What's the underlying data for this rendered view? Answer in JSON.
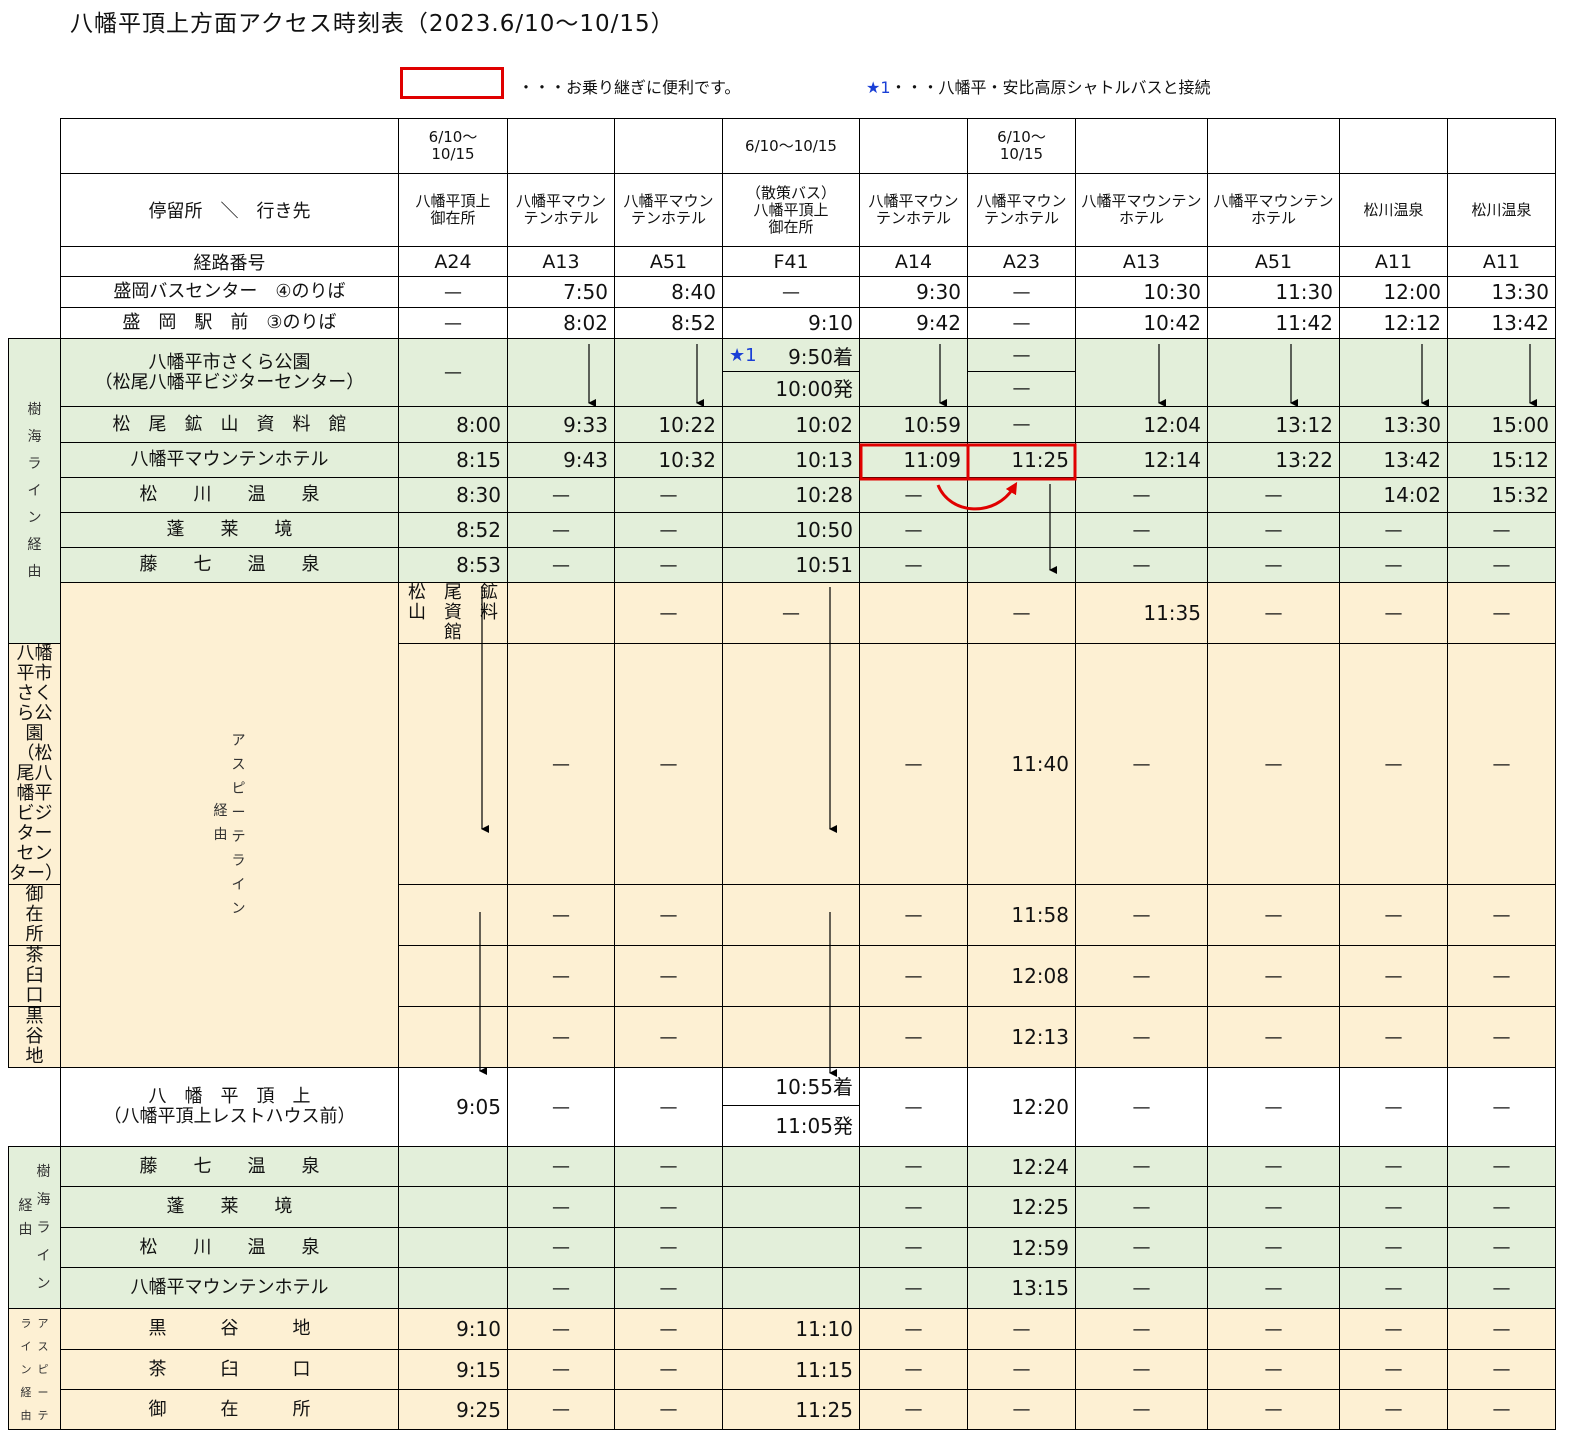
{
  "title": "八幡平頂上方面アクセス時刻表（2023.6/10〜10/15）",
  "legend": {
    "box_text": "・・・お乗り継ぎに便利です。",
    "star_mark": "★1",
    "star_text": "・・・八幡平・安比高原シャトルバスと接続"
  },
  "colors": {
    "green": "#e3efda",
    "yellow": "#fdf0d3",
    "highlight": "#e00000",
    "star": "#1a3fd6"
  },
  "header": {
    "stop_dest_label": "停留所　＼　行き先",
    "route_label": "経路番号",
    "periods": [
      "6/10〜\n10/15",
      "",
      "",
      "6/10〜10/15",
      "",
      "6/10〜\n10/15",
      "",
      "",
      "",
      ""
    ],
    "destinations": [
      "八幡平頂上\n御在所",
      "八幡平マウン\nテンホテル",
      "八幡平マウン\nテンホテル",
      "（散策バス）\n八幡平頂上\n御在所",
      "八幡平マウン\nテンホテル",
      "八幡平マウン\nテンホテル",
      "八幡平マウンテン\nホテル",
      "八幡平マウンテン\nホテル",
      "松川温泉",
      "松川温泉"
    ],
    "routes": [
      "A24",
      "A13",
      "A51",
      "F41",
      "A14",
      "A23",
      "A13",
      "A51",
      "A11",
      "A11"
    ]
  },
  "side_labels": {
    "jukai1": "樹\n海\nラ\nイ\nン\n経\n由",
    "aspite1": "ア\nス\nピ\nー\nテ\nラ\nイ\nン",
    "aspite1_keiyu": "経\n由",
    "jukai2": "樹\n海\nラ\nイ\nン",
    "jukai2_keiyu": "経\n由",
    "aspite2_a": "ラ\nイ\nン\n経\n由",
    "aspite2_b": "ア\nス\nピ\nー\nテ"
  },
  "rows": {
    "morioka_bc": {
      "stop": "盛岡バスセンター　④のりば",
      "times": [
        "—",
        "7:50",
        "8:40",
        "—",
        "9:30",
        "—",
        "10:30",
        "11:30",
        "12:00",
        "13:30"
      ]
    },
    "morioka_st": {
      "stop": "盛　岡　駅　前　③のりば",
      "times": [
        "—",
        "8:02",
        "8:52",
        "9:10",
        "9:42",
        "—",
        "10:42",
        "11:42",
        "12:12",
        "13:42"
      ]
    },
    "sakura1": {
      "stop": "八幡平市さくら公園\n（松尾八幡平ビジターセンター）",
      "a24": "—",
      "f41_star": "★1",
      "f41_arr": "9:50着",
      "f41_dep": "10:00発",
      "a23_top": "—",
      "a23_bot": "—"
    },
    "matsuo_mine1": {
      "stop": "松　尾　鉱　山　資　料　館",
      "times": [
        "8:00",
        "9:33",
        "10:22",
        "10:02",
        "10:59",
        "—",
        "12:04",
        "13:12",
        "13:30",
        "15:00"
      ]
    },
    "mt_hotel1": {
      "stop": "八幡平マウンテンホテル",
      "times": [
        "8:15",
        "9:43",
        "10:32",
        "10:13",
        "11:09",
        "11:25",
        "12:14",
        "13:22",
        "13:42",
        "15:12"
      ]
    },
    "matsukawa1": {
      "stop": "松　　川　　温　　泉",
      "times": [
        "8:30",
        "—",
        "—",
        "10:28",
        "—",
        "",
        "—",
        "—",
        "14:02",
        "15:32"
      ]
    },
    "horai1": {
      "stop": "蓬　　莱　　境",
      "times": [
        "8:52",
        "—",
        "—",
        "10:50",
        "—",
        "",
        "—",
        "—",
        "—",
        "—"
      ]
    },
    "fujishichi1": {
      "stop": "藤　　七　　温　　泉",
      "times": [
        "8:53",
        "—",
        "—",
        "10:51",
        "—",
        "",
        "—",
        "—",
        "—",
        "—"
      ]
    },
    "matsuo_mine2": {
      "stop": "松　尾　鉱　山　資　料　館",
      "times": [
        "",
        "—",
        "—",
        "",
        "—",
        "11:35",
        "—",
        "—",
        "—",
        "—"
      ]
    },
    "sakura2": {
      "stop": "八幡平市さくら公園\n（松尾八幡平ビジターセンター）",
      "times": [
        "",
        "—",
        "—",
        "",
        "—",
        "11:40",
        "—",
        "—",
        "—",
        "—"
      ]
    },
    "gozaisho1": {
      "stop": "御　　　在　　　所",
      "times": [
        "",
        "—",
        "—",
        "",
        "—",
        "11:58",
        "—",
        "—",
        "—",
        "—"
      ]
    },
    "chausu1": {
      "stop": "茶　　　臼　　　口",
      "times": [
        "",
        "—",
        "—",
        "",
        "—",
        "12:08",
        "—",
        "—",
        "—",
        "—"
      ]
    },
    "kuroyachi1": {
      "stop": "黒　　　谷　　　地",
      "times": [
        "",
        "—",
        "—",
        "",
        "—",
        "12:13",
        "—",
        "—",
        "—",
        "—"
      ]
    },
    "summit": {
      "stop": "八　幡　平　頂　上\n（八幡平頂上レストハウス前）",
      "a24": "9:05",
      "f41_arr": "10:55着",
      "f41_dep": "11:05発",
      "others": [
        "—",
        "—",
        "—",
        "12:20",
        "—",
        "—",
        "—",
        "—"
      ]
    },
    "fujishichi2": {
      "stop": "藤　　七　　温　　泉",
      "times": [
        "",
        "—",
        "—",
        "",
        "—",
        "12:24",
        "—",
        "—",
        "—",
        "—"
      ]
    },
    "horai2": {
      "stop": "蓬　　莱　　境",
      "times": [
        "",
        "—",
        "—",
        "",
        "—",
        "12:25",
        "—",
        "—",
        "—",
        "—"
      ]
    },
    "matsukawa2": {
      "stop": "松　　川　　温　　泉",
      "times": [
        "",
        "—",
        "—",
        "",
        "—",
        "12:59",
        "—",
        "—",
        "—",
        "—"
      ]
    },
    "mt_hotel2": {
      "stop": "八幡平マウンテンホテル",
      "times": [
        "",
        "—",
        "—",
        "",
        "—",
        "13:15",
        "—",
        "—",
        "—",
        "—"
      ]
    },
    "kuroyachi2": {
      "stop": "黒　　　谷　　　地",
      "times": [
        "9:10",
        "—",
        "—",
        "11:10",
        "—",
        "—",
        "—",
        "—",
        "—",
        "—"
      ]
    },
    "chausu2": {
      "stop": "茶　　　臼　　　口",
      "times": [
        "9:15",
        "—",
        "—",
        "11:15",
        "—",
        "—",
        "—",
        "—",
        "—",
        "—"
      ]
    },
    "gozaisho2": {
      "stop": "御　　　在　　　所",
      "times": [
        "9:25",
        "—",
        "—",
        "11:25",
        "—",
        "—",
        "—",
        "—",
        "—",
        "—"
      ]
    }
  }
}
